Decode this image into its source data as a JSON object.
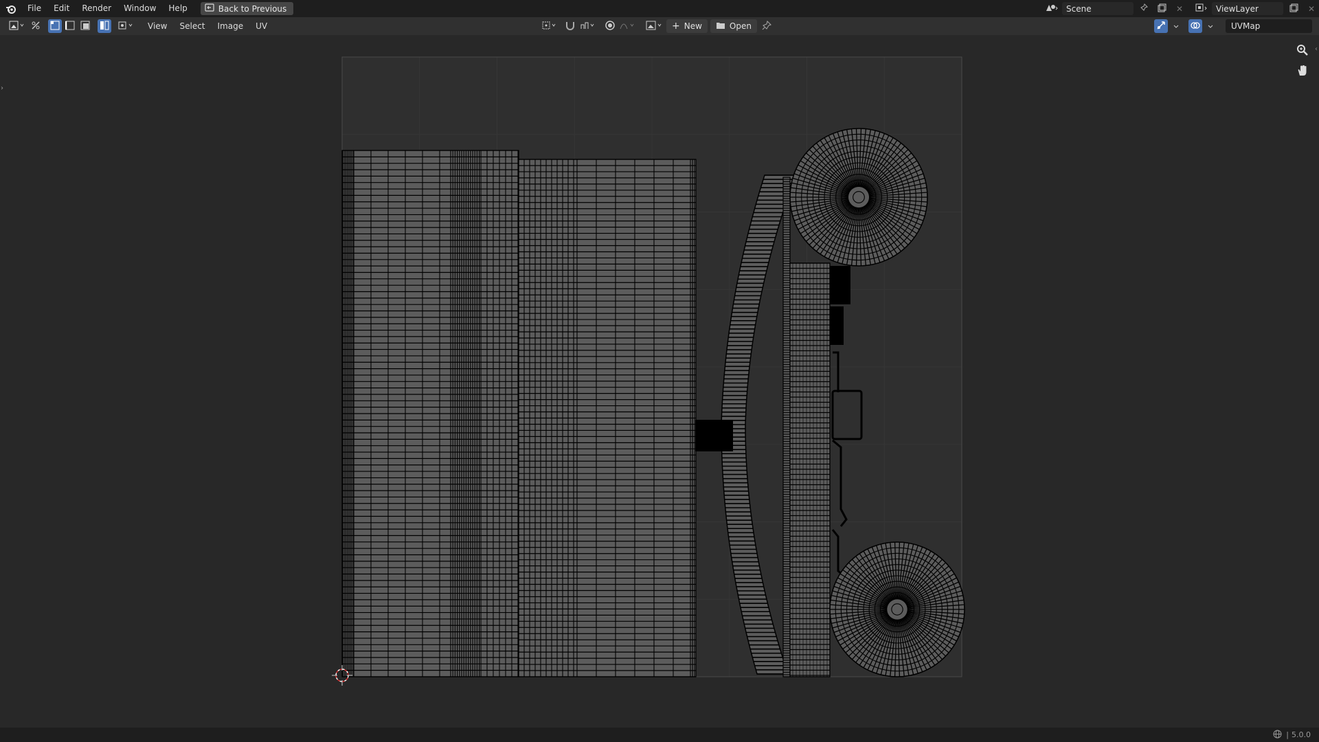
{
  "topbar": {
    "menu": [
      "File",
      "Edit",
      "Render",
      "Window",
      "Help"
    ],
    "back_label": "Back to Previous",
    "scene_name": "Scene",
    "view_layer": "ViewLayer"
  },
  "header": {
    "menus": [
      "View",
      "Select",
      "Image",
      "UV"
    ],
    "new_label": "New",
    "open_label": "Open",
    "uvmap": "UVMap"
  },
  "status": {
    "version": "5.0.0"
  },
  "colors": {
    "accent": "#4772b3",
    "background": "#282828",
    "uv_lines": "#000000",
    "uv_faces": "#5a5a5a"
  },
  "icons": {
    "logo": "blender-logo-icon",
    "zoom": "zoom-icon",
    "pan": "hand-icon",
    "cursor": "2d-cursor-icon"
  }
}
